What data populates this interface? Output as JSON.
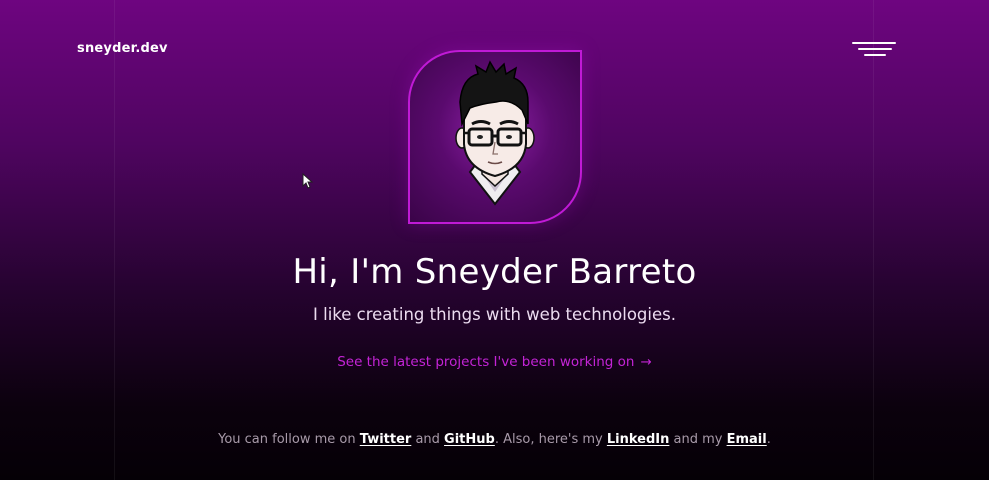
{
  "header": {
    "brand": "sneyder.dev",
    "menu_icon": "hamburger-menu-icon"
  },
  "avatar": {
    "icon": "cartoon-avatar-with-glasses",
    "frame_color": "#c01ad6"
  },
  "hero": {
    "title": "Hi, I'm Sneyder Barreto",
    "subtitle": "I like creating things with web technologies.",
    "projects_link": "See the latest projects I've been working on",
    "projects_arrow": "→"
  },
  "footer": {
    "text_1": "You can follow me on ",
    "twitter": "Twitter",
    "text_2": " and ",
    "github": "GitHub",
    "text_3": ". Also, here's my ",
    "linkedin": "LinkedIn",
    "text_4": " and my ",
    "email": "Email",
    "text_5": "."
  },
  "colors": {
    "accent": "#c424d6",
    "background_top": "#6e0580",
    "background_bottom": "#050006"
  }
}
